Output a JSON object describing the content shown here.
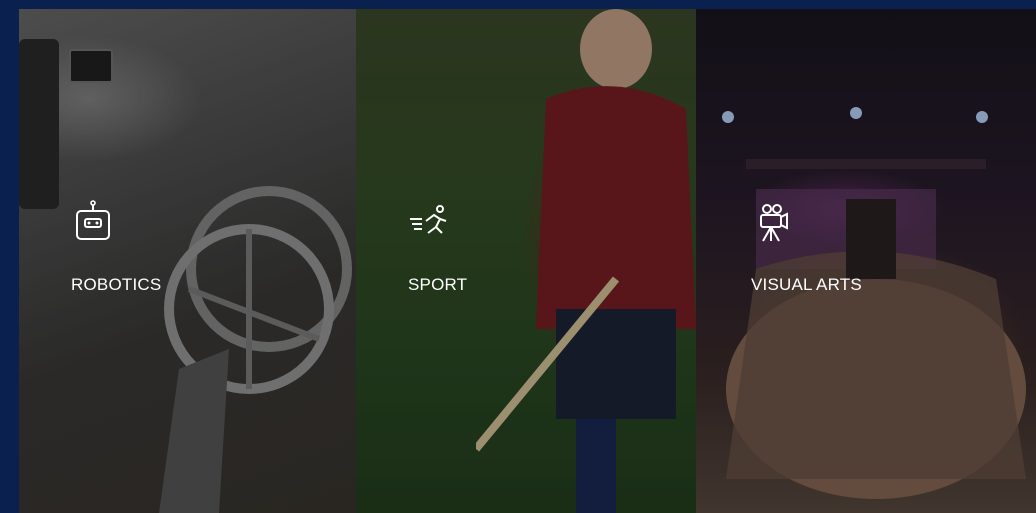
{
  "tiles": [
    {
      "label": "ROBOTICS",
      "icon": "robot-icon"
    },
    {
      "label": "SPORT",
      "icon": "running-person-icon"
    },
    {
      "label": "VISUAL ARTS",
      "icon": "film-camera-icon"
    }
  ],
  "colors": {
    "frame": "#0a2150",
    "text": "#ffffff"
  }
}
